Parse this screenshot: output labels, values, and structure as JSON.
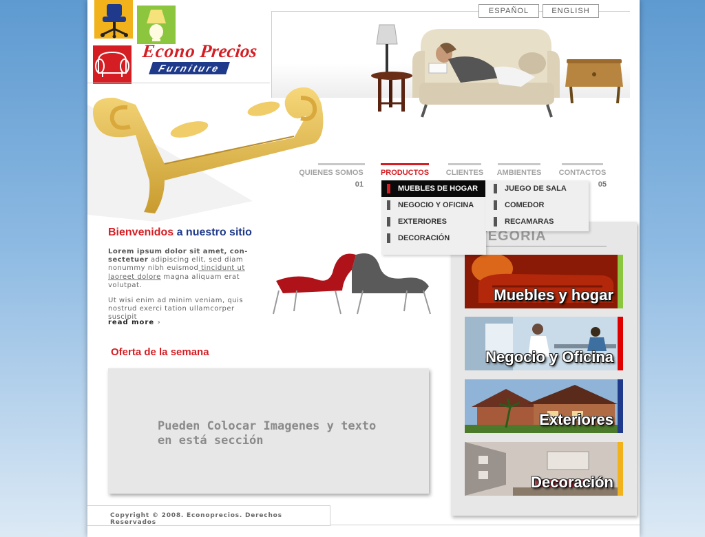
{
  "logo": {
    "brand": "Econo Precios",
    "brand_word1": "Econo",
    "brand_word2": "Precios",
    "sub": "Furniture",
    "icons": [
      "office-chair-icon",
      "lamp-icon",
      "armchair-icon"
    ],
    "colors": {
      "red": "#d41e23",
      "blue": "#1f3a8a",
      "yellow": "#f2b21b",
      "green": "#8cc63e"
    }
  },
  "languages": [
    {
      "label": "ESPAÑOL"
    },
    {
      "label": "ENGLISH"
    }
  ],
  "nav": [
    {
      "label": "QUIENES SOMOS",
      "num": "01"
    },
    {
      "label": "PRODUCTOS",
      "num": "",
      "active": true
    },
    {
      "label": "CLIENTES",
      "num": ""
    },
    {
      "label": "AMBIENTES",
      "num": ""
    },
    {
      "label": "CONTACTOS",
      "num": "05"
    }
  ],
  "dropdown_products": [
    {
      "label": "MUEBLES DE HOGAR",
      "selected": true
    },
    {
      "label": "NEGOCIO Y OFICINA"
    },
    {
      "label": "EXTERIORES"
    },
    {
      "label": "DECORACIÓN"
    }
  ],
  "dropdown_sub": [
    {
      "label": "JUEGO DE SALA"
    },
    {
      "label": "COMEDOR"
    },
    {
      "label": "RECAMARAS"
    }
  ],
  "welcome": {
    "title_red": "Bienvenidos",
    "title_rest": " a nuestro sitio",
    "p1_bold": "Lorem ipsum dolor sit amet, con-sectetuer",
    "p1_text": " adipiscing elit, sed diam nonummy nibh euismod",
    "p1_link": " tincidunt ut laoreet dolore",
    "p1_end": " magna aliquam erat volutpat.",
    "p2": "Ut wisi enim ad minim veniam, quis nostrud exerci tation ullamcorper suscipit",
    "read_more": "read more"
  },
  "oferta": {
    "title": "Oferta de la semana",
    "line1": "Pueden Colocar Imagenes y texto",
    "line2": "en está sección"
  },
  "categoria": {
    "title": "CATEGORIA",
    "tiles": [
      {
        "label": "Muebles y hogar",
        "accent": "#8cc63e"
      },
      {
        "label": "Negocio y Oficina",
        "accent": "#e00000"
      },
      {
        "label": "Exteriores",
        "accent": "#1f3a8a"
      },
      {
        "label": "Decoración",
        "accent": "#f2b21b"
      }
    ]
  },
  "footer": {
    "text": "Copyright © 2008. Econoprecios. Derechos Reservados"
  }
}
